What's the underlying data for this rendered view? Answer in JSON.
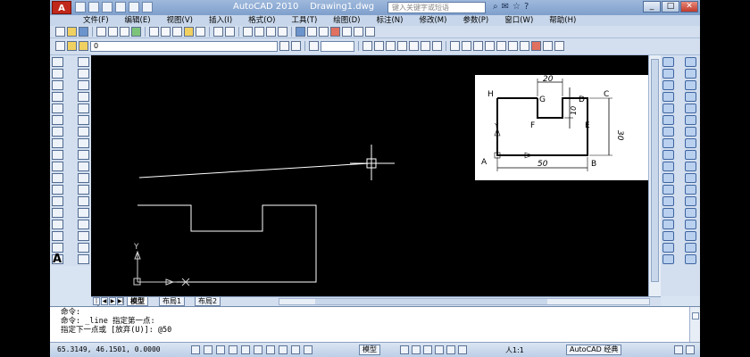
{
  "app": {
    "title": "AutoCAD 2010",
    "document": "Drawing1.dwg",
    "logo": "A",
    "search_placeholder": "键入关键字或短语"
  },
  "menu": [
    "文件(F)",
    "编辑(E)",
    "视图(V)",
    "插入(I)",
    "格式(O)",
    "工具(T)",
    "绘图(D)",
    "标注(N)",
    "修改(M)",
    "参数(P)",
    "窗口(W)",
    "帮助(H)"
  ],
  "layer_combo": "0",
  "reference": {
    "labels": {
      "H": "H",
      "G": "G",
      "D": "D",
      "C": "C",
      "F": "F",
      "E": "E",
      "A": "A",
      "B": "B"
    },
    "dims": {
      "top": "20",
      "notch": "10",
      "height": "30",
      "width": "50"
    },
    "y_axis": "Y"
  },
  "ucs": {
    "y_label": "Y"
  },
  "tabs": {
    "model": "模型",
    "layout1": "布局1",
    "layout2": "布局2"
  },
  "command": {
    "line1": "命令:",
    "line2": "命令: _line 指定第一点:",
    "line3": "指定下一点或 [放弃(U)]: @50"
  },
  "status": {
    "coords": "65.3149,  46.1501, 0.0000",
    "model": "模型",
    "scale": "人1:1",
    "workspace": "AutoCAD 经典"
  },
  "colors": {
    "canvas": "#000000",
    "line": "#ffffff",
    "ucs": "#cfcfcf"
  }
}
